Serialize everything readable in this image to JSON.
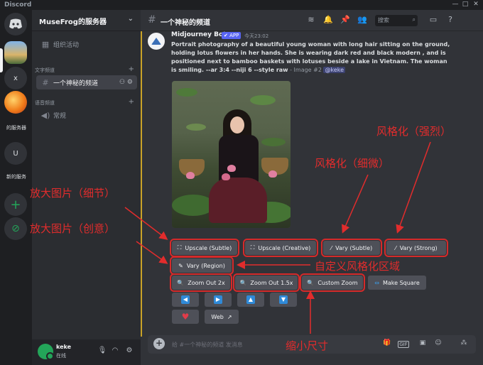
{
  "titlebar": {
    "app": "Discord",
    "min": "—",
    "max": "□",
    "close": "✕"
  },
  "servers": {
    "items": [
      {
        "label": "",
        "glyph": "◉"
      },
      {
        "label": "",
        "glyph": ""
      },
      {
        "label": "",
        "glyph": "x"
      },
      {
        "label": "的服务器",
        "glyph": ""
      },
      {
        "label": "",
        "glyph": "U"
      },
      {
        "label": "新的服务",
        "glyph": ""
      },
      {
        "label": "",
        "glyph": "+"
      },
      {
        "label": "",
        "glyph": "⊘"
      }
    ]
  },
  "sidebar": {
    "server_name": "MuseFrog的服务器",
    "chevron": "⌄",
    "events": "组织活动",
    "text_category": "文字频道",
    "active_channel": "一个神秘的频道",
    "voice_category": "语音频道",
    "voice_channel": "常规"
  },
  "user": {
    "name": "keke",
    "status": "在线"
  },
  "header": {
    "channel": "一个神秘的频道",
    "search_placeholder": "搜索"
  },
  "message": {
    "author": "Midjourney Bot",
    "badge": "✔ APP",
    "time": "今天23:02",
    "prompt": "Portrait photography of a beautiful young woman with long hair sitting on the ground, holding lotus flowers in her hands. She is wearing dark red and black modern , and is positioned next to bamboo baskets with lotuses beside a lake in Vietnam. The woman is smiling. --ar 3:4 --niji 6 --style raw",
    "meta": " - Image #2 ",
    "mention": "@keke"
  },
  "buttons": {
    "upscale_subtle": "Upscale (Subtle)",
    "upscale_creative": "Upscale (Creative)",
    "vary_subtle": "Vary (Subtle)",
    "vary_strong": "Vary (Strong)",
    "vary_region": "Vary (Region)",
    "zoom_out_2x": "Zoom Out 2x",
    "zoom_out_15x": "Zoom Out 1.5x",
    "custom_zoom": "Custom Zoom",
    "make_square": "Make Square",
    "web": "Web"
  },
  "composer": {
    "placeholder": "给 #一个神秘的频道 发消息"
  },
  "annotations": {
    "stylize_strong": "风格化（强烈）",
    "stylize_subtle": "风格化（细微）",
    "upscale_detail": "放大图片（细节）",
    "upscale_creative": "放大图片（创意）",
    "custom_region": "自定义风格化区域",
    "zoom_out": "缩小尺寸"
  },
  "colors": {
    "highlight": "#d52a2a",
    "annotation": "#e22c2c",
    "accent": "#5865f2",
    "online": "#23a559"
  }
}
